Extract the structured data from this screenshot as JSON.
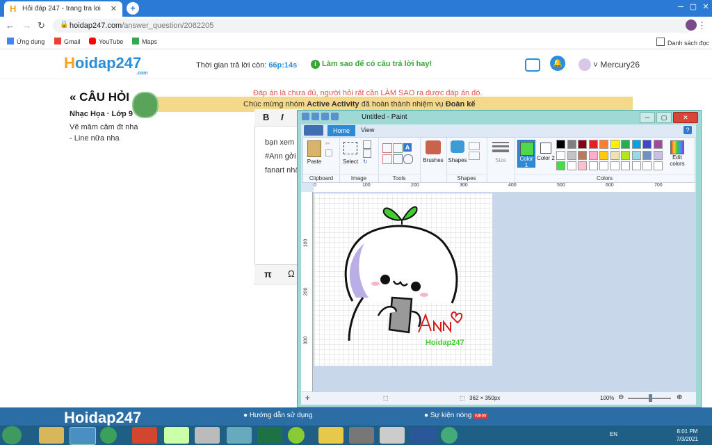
{
  "browser": {
    "tab_title": "Hỏi đáp 247 - trang tra loi",
    "tab_favicon": "H",
    "new_tab": "+",
    "url_host": "hoidap247.com",
    "url_path": "/answer_question/2082205",
    "bookmarks": [
      {
        "label": "Ứng dụng",
        "icon": "apps-icon"
      },
      {
        "label": "Gmail",
        "icon": "gmail-icon"
      },
      {
        "label": "YouTube",
        "icon": "youtube-icon"
      },
      {
        "label": "Maps",
        "icon": "maps-icon"
      }
    ],
    "reading_list": "Danh sách đọc"
  },
  "site": {
    "logo": "oidap247",
    "logo_h": "H",
    "logo_com": ".com",
    "timer_label": "Thời gian trả lời còn:",
    "timer_value": "66p:14s",
    "tip": "Làm sao để có câu trả lời hay!",
    "username": "Mercury26",
    "question_title": "« CÂU HỎI",
    "question_meta": "Nhạc Họa · Lớp 9",
    "question_lines": [
      "Vẽ mâm câm đt nha",
      "- Line nữa nha"
    ],
    "answer_note": "Đáp án là chưa đủ, người hỏi rất cần LÀM SAO ra được đáp án đó.",
    "banner_pre": "Chúc mừng nhóm ",
    "banner_group": "Active Activity",
    "banner_mid": " đã hoàn thành nhiệm vụ ",
    "banner_end": "Đoàn kế",
    "editor_bold": "B",
    "editor_italic": "I",
    "editor_lines": [
      "bạn xem",
      "#Ann gởi",
      "fanart nhà"
    ],
    "editor_pi": "π",
    "editor_omega": "Ω",
    "footer_logo": "Hoidap247",
    "footer_link1": "Hướng dẫn sử dụng",
    "footer_link2": "Sự kiện nóng",
    "footer_new": "NEW"
  },
  "paint": {
    "title": "Untitled - Paint",
    "tabs": {
      "home": "Home",
      "view": "View"
    },
    "groups": {
      "clipboard": "Clipboard",
      "image": "Image",
      "tools": "Tools",
      "shapes": "Shapes",
      "colors": "Colors"
    },
    "buttons": {
      "paste": "Paste",
      "select": "Select",
      "brushes": "Brushes",
      "shapes": "Shapes",
      "size": "Size",
      "color1": "Color 1",
      "color2": "Color 2",
      "edit_colors": "Edit colors"
    },
    "ruler_h": [
      "0",
      "100",
      "200",
      "300",
      "400",
      "500",
      "600",
      "700"
    ],
    "ruler_v": [
      "100",
      "200",
      "300"
    ],
    "palette": [
      "#000000",
      "#7f7f7f",
      "#880015",
      "#ed1c24",
      "#ff7f27",
      "#fff200",
      "#22b14c",
      "#00a2e8",
      "#3f48cc",
      "#a349a4",
      "#ffffff",
      "#c3c3c3",
      "#b97a57",
      "#ffaec9",
      "#ffc90e",
      "#efe4b0",
      "#b5e61d",
      "#99d9ea",
      "#7092be",
      "#c8bfe7",
      "#44dd44",
      "#ffffff",
      "#ffc0cb",
      "#ffffff",
      "#ffffff",
      "#ffffff",
      "#ffffff",
      "#ffffff",
      "#ffffff",
      "#ffffff"
    ],
    "color1": "#4cd94c",
    "color2": "#ffffff",
    "canvas_signature": "Ann",
    "canvas_watermark": "Hoidap247",
    "status_size": "362 × 350px",
    "zoom": "100%"
  },
  "taskbar": {
    "language": "EN",
    "time": "8:01 PM",
    "date": "7/3/2021"
  }
}
